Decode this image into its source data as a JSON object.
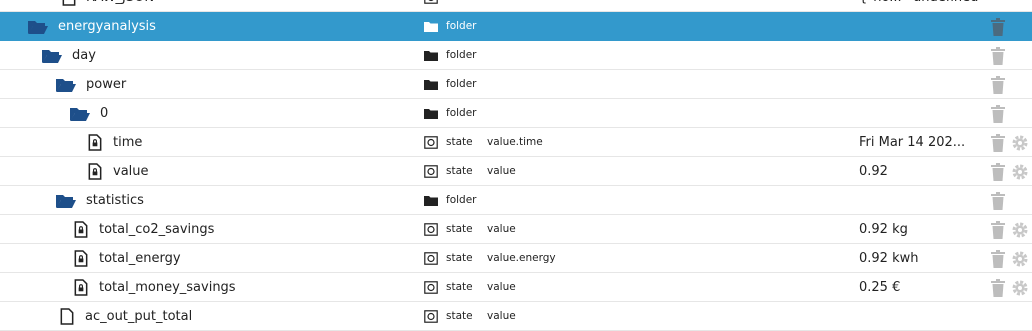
{
  "colors": {
    "selected_row": "#3399cc",
    "folder_icon": "#1e4f8a",
    "trash": "#bdbdbd",
    "gear": "#c8c8c8"
  },
  "rows": [
    {
      "name": "RAW_JSON",
      "type": "state",
      "role": "value",
      "value": "{\"no...",
      "value2": "undefined"
    },
    {
      "name": "energyanalysis",
      "type": "folder",
      "role": "",
      "value": ""
    },
    {
      "name": "day",
      "type": "folder",
      "role": "",
      "value": ""
    },
    {
      "name": "power",
      "type": "folder",
      "role": "",
      "value": ""
    },
    {
      "name": "0",
      "type": "folder",
      "role": "",
      "value": ""
    },
    {
      "name": "time",
      "type": "state",
      "role": "value.time",
      "value": "Fri Mar 14 202..."
    },
    {
      "name": "value",
      "type": "state",
      "role": "value",
      "value": "0.92"
    },
    {
      "name": "statistics",
      "type": "folder",
      "role": "",
      "value": ""
    },
    {
      "name": "total_co2_savings",
      "type": "state",
      "role": "value",
      "value": "0.92 kg"
    },
    {
      "name": "total_energy",
      "type": "state",
      "role": "value.energy",
      "value": "0.92 kwh"
    },
    {
      "name": "total_money_savings",
      "type": "state",
      "role": "value",
      "value": "0.25 €"
    },
    {
      "name": "ac_out_put_total",
      "type": "state",
      "role": "value",
      "value": ""
    }
  ]
}
